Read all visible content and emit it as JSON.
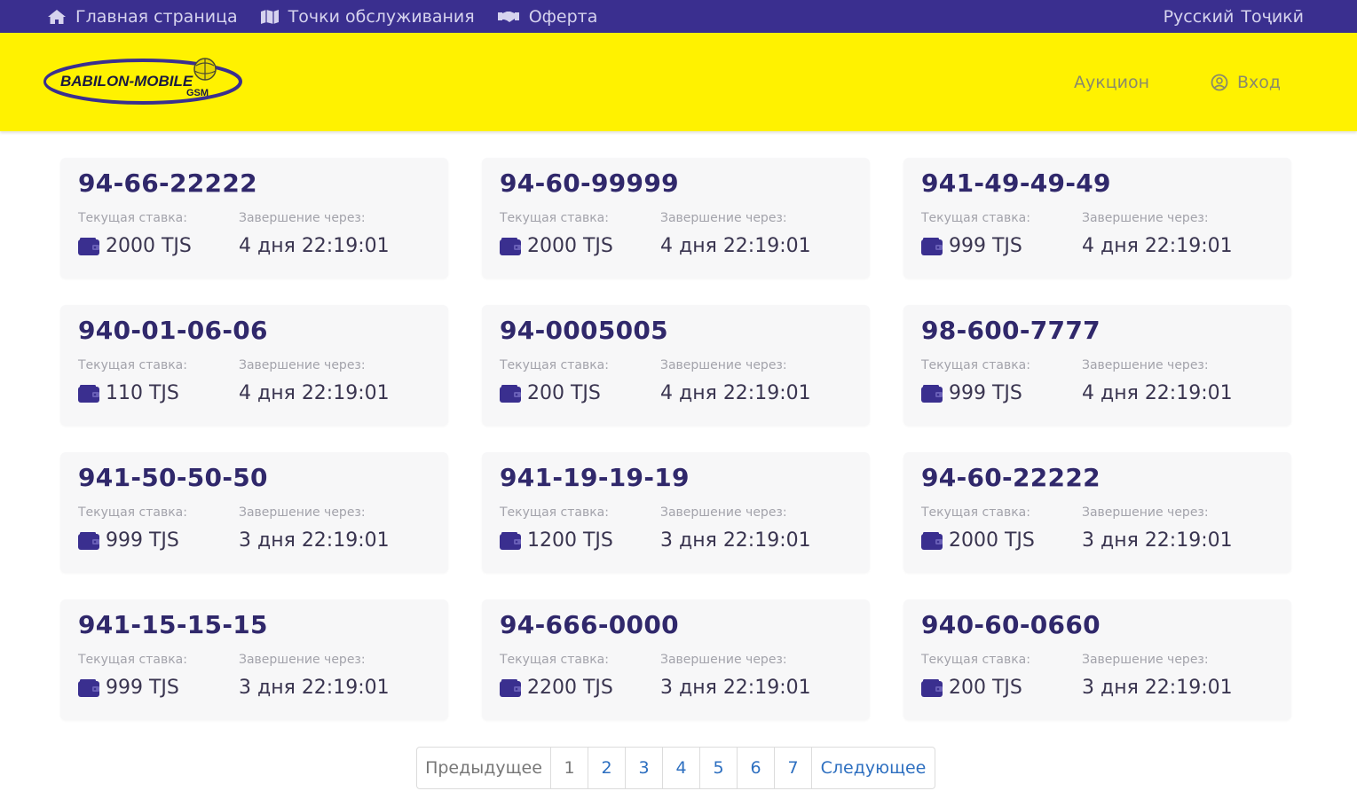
{
  "topbar": {
    "nav": [
      {
        "label": "Главная страница",
        "icon": "home-icon"
      },
      {
        "label": "Точки обслуживания",
        "icon": "map-icon"
      },
      {
        "label": "Оферта",
        "icon": "handshake-icon"
      }
    ],
    "languages": [
      "Русский",
      "Тоҷикӣ"
    ]
  },
  "header": {
    "logo_text": "BABILON-MOBILE",
    "logo_sub": "GSM",
    "auction_label": "Аукцион",
    "login_label": "Вход"
  },
  "labels": {
    "bid": "Текущая ставка:",
    "ends": "Завершение через:"
  },
  "lots": [
    {
      "number": "94-66-22222",
      "bid": "2000 TJS",
      "ends": "4 дня 22:19:01"
    },
    {
      "number": "94-60-99999",
      "bid": "2000 TJS",
      "ends": "4 дня 22:19:01"
    },
    {
      "number": "941-49-49-49",
      "bid": "999 TJS",
      "ends": "4 дня 22:19:01"
    },
    {
      "number": "940-01-06-06",
      "bid": "110 TJS",
      "ends": "4 дня 22:19:01"
    },
    {
      "number": "94-0005005",
      "bid": "200 TJS",
      "ends": "4 дня 22:19:01"
    },
    {
      "number": "98-600-7777",
      "bid": "999 TJS",
      "ends": "4 дня 22:19:01"
    },
    {
      "number": "941-50-50-50",
      "bid": "999 TJS",
      "ends": "3 дня 22:19:01"
    },
    {
      "number": "941-19-19-19",
      "bid": "1200 TJS",
      "ends": "3 дня 22:19:01"
    },
    {
      "number": "94-60-22222",
      "bid": "2000 TJS",
      "ends": "3 дня 22:19:01"
    },
    {
      "number": "941-15-15-15",
      "bid": "999 TJS",
      "ends": "3 дня 22:19:01"
    },
    {
      "number": "94-666-0000",
      "bid": "2200 TJS",
      "ends": "3 дня 22:19:01"
    },
    {
      "number": "940-60-0660",
      "bid": "200 TJS",
      "ends": "3 дня 22:19:01"
    }
  ],
  "pagination": {
    "prev": "Предыдущее",
    "pages": [
      "1",
      "2",
      "3",
      "4",
      "5",
      "6",
      "7"
    ],
    "current": "1",
    "next": "Следующее"
  },
  "colors": {
    "topbar": "#3a2f8f",
    "header": "#fff200",
    "number": "#30286b",
    "link": "#2d6fc0"
  }
}
